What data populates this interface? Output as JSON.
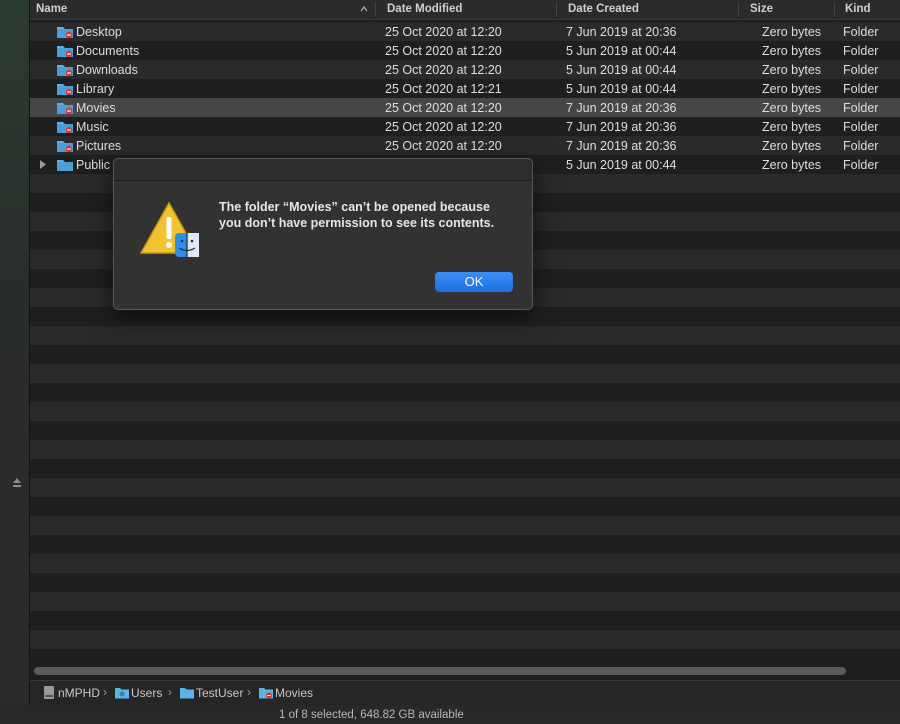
{
  "columns": {
    "name": "Name",
    "date_modified": "Date Modified",
    "date_created": "Date Created",
    "size": "Size",
    "kind": "Kind"
  },
  "rows": [
    {
      "name": "Desktop",
      "modified": "25 Oct 2020 at 12:20",
      "created": "7 Jun 2019 at 20:36",
      "size": "Zero bytes",
      "kind": "Folder"
    },
    {
      "name": "Documents",
      "modified": "25 Oct 2020 at 12:20",
      "created": "5 Jun 2019 at 00:44",
      "size": "Zero bytes",
      "kind": "Folder"
    },
    {
      "name": "Downloads",
      "modified": "25 Oct 2020 at 12:20",
      "created": "5 Jun 2019 at 00:44",
      "size": "Zero bytes",
      "kind": "Folder"
    },
    {
      "name": "Library",
      "modified": "25 Oct 2020 at 12:21",
      "created": "5 Jun 2019 at 00:44",
      "size": "Zero bytes",
      "kind": "Folder"
    },
    {
      "name": "Movies",
      "modified": "25 Oct 2020 at 12:20",
      "created": "7 Jun 2019 at 20:36",
      "size": "Zero bytes",
      "kind": "Folder"
    },
    {
      "name": "Music",
      "modified": "25 Oct 2020 at 12:20",
      "created": "7 Jun 2019 at 20:36",
      "size": "Zero bytes",
      "kind": "Folder"
    },
    {
      "name": "Pictures",
      "modified": "25 Oct 2020 at 12:20",
      "created": "7 Jun 2019 at 20:36",
      "size": "Zero bytes",
      "kind": "Folder"
    },
    {
      "name": "Public",
      "modified": "",
      "created": "5 Jun 2019 at 00:44",
      "size": "Zero bytes",
      "kind": "Folder"
    }
  ],
  "selected_row": "Movies",
  "pathbar": {
    "items": [
      "nMPHD",
      "Users",
      "TestUser",
      "Movies"
    ]
  },
  "status": {
    "text": "1 of 8 selected, 648.82 GB available"
  },
  "dialog": {
    "message": "The folder “Movies” can’t be opened because you don’t have permission to see its contents.",
    "ok_label": "OK"
  },
  "icons": {
    "warning": "warning-triangle-icon",
    "finder": "finder-icon",
    "folder": "folder-icon",
    "drive": "drive-icon"
  },
  "colors": {
    "accent": "#1f6fde",
    "folder": "#5db2e6",
    "no_access_badge": "#e0312b"
  }
}
